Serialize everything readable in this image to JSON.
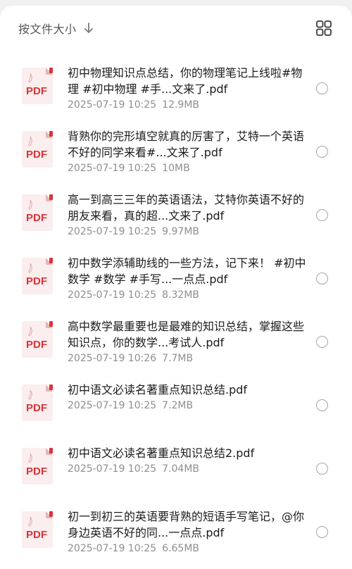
{
  "toolbar": {
    "sort_label": "按文件大小",
    "sort_icon": "arrow-down-icon",
    "view_icon": "grid-view-icon"
  },
  "colors": {
    "pdf_red": "#d9343a",
    "pdf_bg": "#fbeeee",
    "text_primary": "#1b1b1b",
    "text_secondary": "#8e8e8e"
  },
  "pdf_badge": "PDF",
  "files": [
    {
      "name": "初中物理知识点总结，你的物理笔记上线啦#物理 #初中物理 #手...文来了.pdf",
      "date": "2025-07-19 10:25",
      "size": "12.9MB",
      "selected": false
    },
    {
      "name": "背熟你的完形填空就真的厉害了，艾特一个英语不好的同学来看#...文来了.pdf",
      "date": "2025-07-19 10:25",
      "size": "10MB",
      "selected": false
    },
    {
      "name": "高一到高三三年的英语语法，艾特你英语不好的朋友来看，真的超...文来了.pdf",
      "date": "2025-07-19 10:25",
      "size": "9.97MB",
      "selected": false
    },
    {
      "name": "初中数学添辅助线的一些方法，记下来！ #初中数学 #数学 #手写...一点点.pdf",
      "date": "2025-07-19 10:25",
      "size": "8.32MB",
      "selected": false
    },
    {
      "name": "高中数学最重要也是最难的知识总结，掌握这些知识点，你的数学...考试人.pdf",
      "date": "2025-07-19 10:26",
      "size": "7.7MB",
      "selected": false
    },
    {
      "name": "初中语文必读名著重点知识总结.pdf",
      "date": "2025-07-19 10:25",
      "size": "7.2MB",
      "selected": false
    },
    {
      "name": "初中语文必读名著重点知识总结2.pdf",
      "date": "2025-07-19 10:25",
      "size": "7.04MB",
      "selected": false
    },
    {
      "name": "初一到初三的英语要背熟的短语手写笔记，@你身边英语不好的同...一点点.pdf",
      "date": "2025-07-19 10:25",
      "size": "6.65MB",
      "selected": false
    }
  ]
}
